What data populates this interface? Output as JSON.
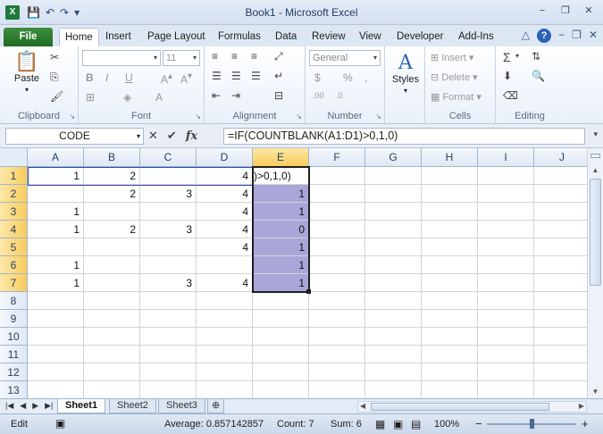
{
  "window": {
    "title": "Book1 - Microsoft Excel",
    "app_icon": "X",
    "minimize": "−",
    "restore": "❐",
    "close": "✕"
  },
  "qat": {
    "save": "💾",
    "undo": "↶",
    "redo": "↷",
    "customize": "▾"
  },
  "tabs": [
    "File",
    "Home",
    "Insert",
    "Page Layout",
    "Formulas",
    "Data",
    "Review",
    "View",
    "Developer",
    "Add-Ins"
  ],
  "ribbon": {
    "clipboard": {
      "label": "Clipboard",
      "paste": "Paste"
    },
    "font": {
      "label": "Font",
      "size": "11",
      "bold": "B",
      "italic": "I",
      "underline": "U"
    },
    "alignment": {
      "label": "Alignment"
    },
    "number": {
      "label": "Number",
      "format": "General",
      "currency": "$",
      "percent": "%",
      "comma": ",",
      "inc": ".00",
      "dec": ".0"
    },
    "styles": {
      "label": "Styles"
    },
    "cells": {
      "label": "Cells",
      "insert": "Insert",
      "delete": "Delete",
      "format": "Format"
    },
    "editing": {
      "label": "Editing",
      "sum": "Σ"
    }
  },
  "formula_bar": {
    "name_box": "CODE",
    "cancel": "✕",
    "enter": "✔",
    "fx": "fx",
    "formula": "=IF(COUNTBLANK(A1:D1)>0,1,0)"
  },
  "columns": [
    "A",
    "B",
    "C",
    "D",
    "E",
    "F",
    "G",
    "H",
    "I",
    "J"
  ],
  "rows": [
    "1",
    "2",
    "3",
    "4",
    "5",
    "6",
    "7",
    "8",
    "9",
    "10",
    "11",
    "12",
    "13"
  ],
  "cells": {
    "A1": "1",
    "B1": "2",
    "D1": "4",
    "E1": ")>0,1,0)",
    "B2": "2",
    "C2": "3",
    "D2": "4",
    "E2": "1",
    "A3": "1",
    "D3": "4",
    "E3": "1",
    "A4": "1",
    "B4": "2",
    "C4": "3",
    "D4": "4",
    "E4": "0",
    "D5": "4",
    "E5": "1",
    "A6": "1",
    "E6": "1",
    "A7": "1",
    "C7": "3",
    "D7": "4",
    "E7": "1"
  },
  "sheets": [
    "Sheet1",
    "Sheet2",
    "Sheet3"
  ],
  "status": {
    "mode": "Edit",
    "average": "Average: 0.857142857",
    "count": "Count: 7",
    "sum": "Sum: 6",
    "zoom": "100%",
    "zoom_out": "−",
    "zoom_in": "+"
  }
}
